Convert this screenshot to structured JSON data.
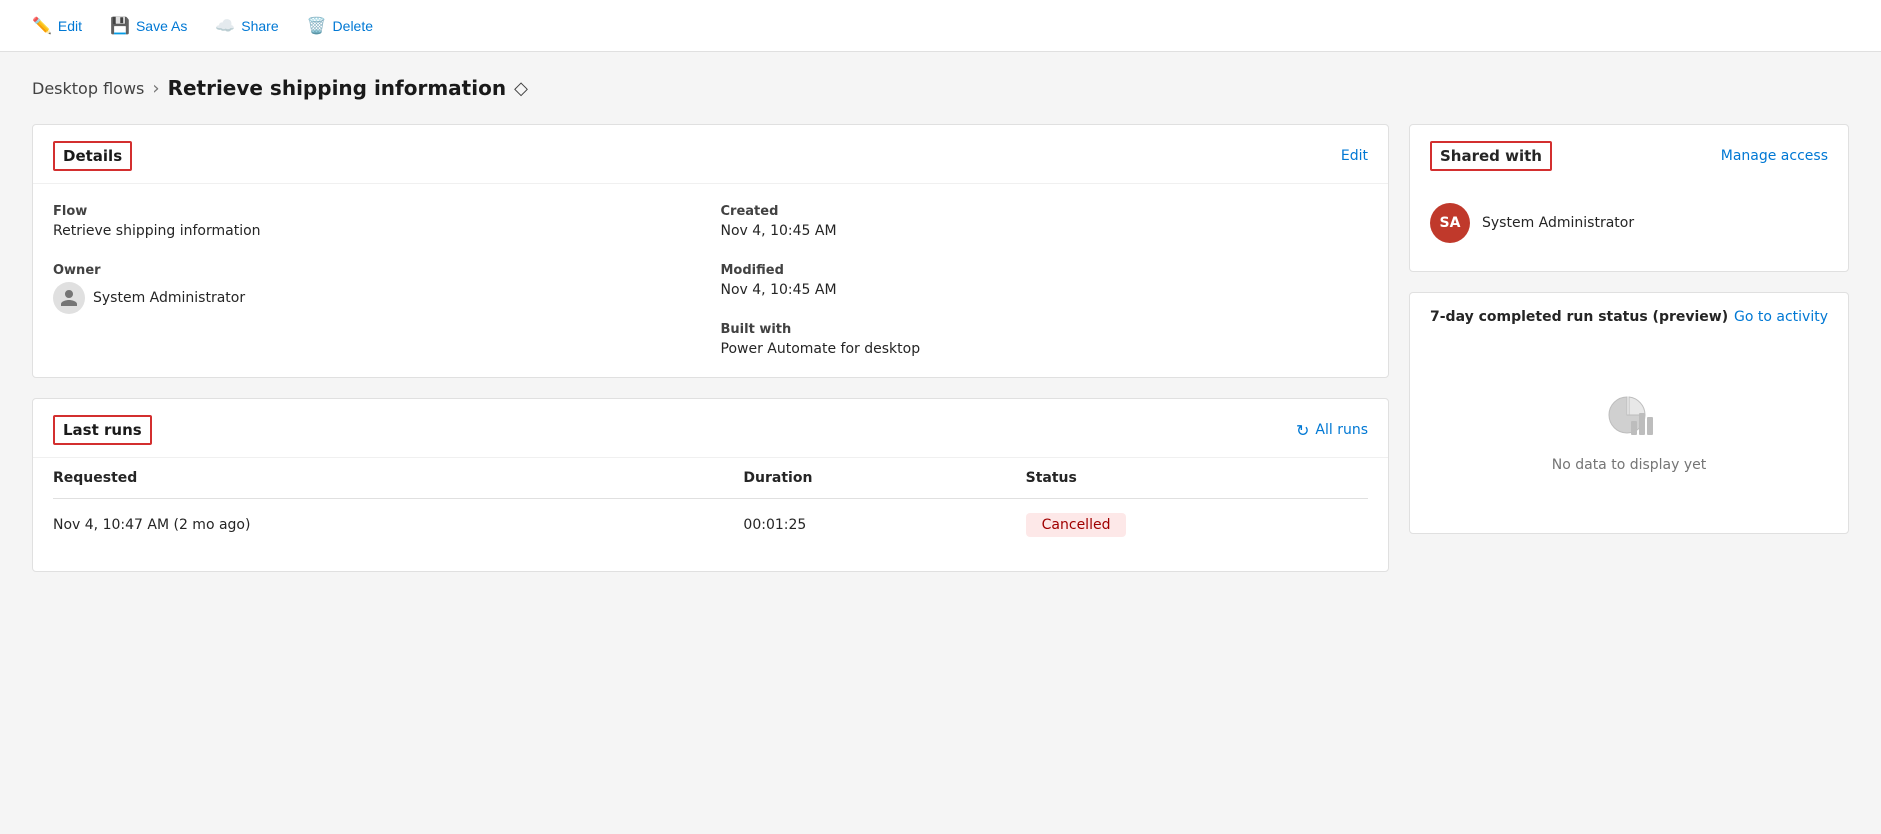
{
  "toolbar": {
    "edit_label": "Edit",
    "saveas_label": "Save As",
    "share_label": "Share",
    "delete_label": "Delete"
  },
  "breadcrumb": {
    "parent_label": "Desktop flows",
    "separator": "›",
    "current_label": "Retrieve shipping information"
  },
  "details_card": {
    "title": "Details",
    "edit_link": "Edit",
    "flow_label": "Flow",
    "flow_value": "Retrieve shipping information",
    "owner_label": "Owner",
    "owner_value": "System Administrator",
    "created_label": "Created",
    "created_value": "Nov 4, 10:45 AM",
    "modified_label": "Modified",
    "modified_value": "Nov 4, 10:45 AM",
    "built_label": "Built with",
    "built_value": "Power Automate for desktop"
  },
  "last_runs_card": {
    "title": "Last runs",
    "all_runs_link": "All runs",
    "columns": {
      "requested": "Requested",
      "duration": "Duration",
      "status": "Status"
    },
    "rows": [
      {
        "requested": "Nov 4, 10:47 AM (2 mo ago)",
        "duration": "00:01:25",
        "status": "Cancelled",
        "status_type": "cancelled"
      }
    ]
  },
  "shared_with_card": {
    "title": "Shared with",
    "manage_access_link": "Manage access",
    "users": [
      {
        "initials": "SA",
        "name": "System Administrator"
      }
    ]
  },
  "activity_card": {
    "title": "7-day completed run status (preview)",
    "go_to_activity_link": "Go to activity",
    "no_data_text": "No data to display yet"
  }
}
